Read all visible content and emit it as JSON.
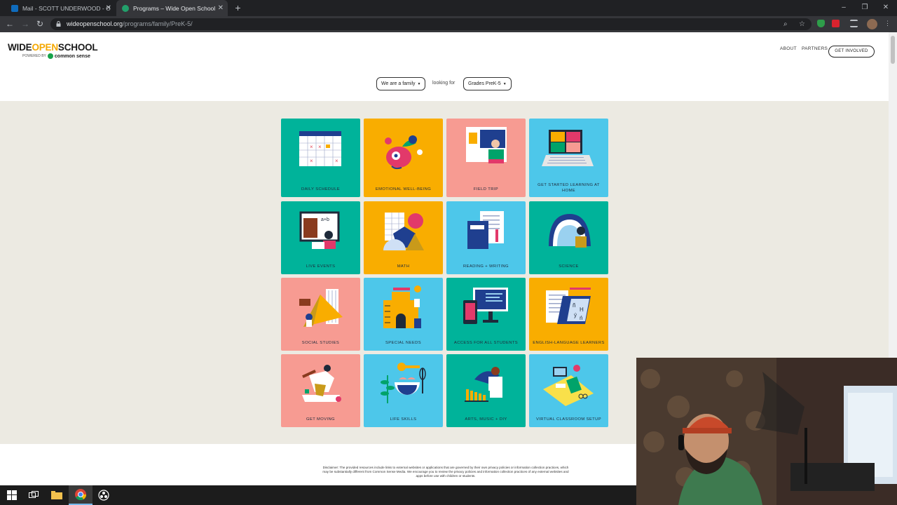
{
  "browser": {
    "tabs": [
      {
        "title": "Mail - SCOTT UNDERWOOD - O",
        "favicon_color": "#0f6cbd"
      },
      {
        "title": "Programs – Wide Open School",
        "favicon_color": "#22a06b"
      }
    ],
    "url_host": "wideopenschool.org",
    "url_path": "/programs/family/PreK-5/"
  },
  "site": {
    "logo_wide": "WIDE",
    "logo_open": "OPEN",
    "logo_school": "SCHOOL",
    "powered_by": "POWERED BY",
    "common_sense": "common sense",
    "nav": {
      "about": "ABOUT",
      "partners": "PARTNERS",
      "get_involved": "GET INVOLVED"
    }
  },
  "filters": {
    "audience": "We are a family",
    "looking_for": "looking for",
    "grades": "Grades PreK-5"
  },
  "tiles": [
    {
      "label": "DAILY SCHEDULE",
      "color": "#00b39a"
    },
    {
      "label": "EMOTIONAL WELL-BEING",
      "color": "#f9ad00"
    },
    {
      "label": "FIELD TRIP",
      "color": "#f79b92"
    },
    {
      "label": "GET STARTED LEARNING AT HOME",
      "color": "#4dc7ea"
    },
    {
      "label": "LIVE EVENTS",
      "color": "#00b39a"
    },
    {
      "label": "MATH",
      "color": "#f9ad00"
    },
    {
      "label": "READING + WRITING",
      "color": "#4dc7ea"
    },
    {
      "label": "SCIENCE",
      "color": "#00b39a"
    },
    {
      "label": "SOCIAL STUDIES",
      "color": "#f79b92"
    },
    {
      "label": "SPECIAL NEEDS",
      "color": "#4dc7ea"
    },
    {
      "label": "ACCESS FOR ALL STUDENTS",
      "color": "#00b39a"
    },
    {
      "label": "ENGLISH-LANGUAGE LEARNERS",
      "color": "#f9ad00"
    },
    {
      "label": "GET MOVING",
      "color": "#f79b92"
    },
    {
      "label": "LIFE SKILLS",
      "color": "#4dc7ea"
    },
    {
      "label": "ARTS, MUSIC + DIY",
      "color": "#00b39a"
    },
    {
      "label": "VIRTUAL CLASSROOM SETUP",
      "color": "#4dc7ea"
    }
  ],
  "disclaimer": "Disclaimer: The provided resources include links to external websites or applications that are governed by their own privacy policies or information collection practices, which may be substantially different from Common Sense Media. We encourage you to review the privacy policies and information collection practices of any external websites and apps before use with children or students."
}
